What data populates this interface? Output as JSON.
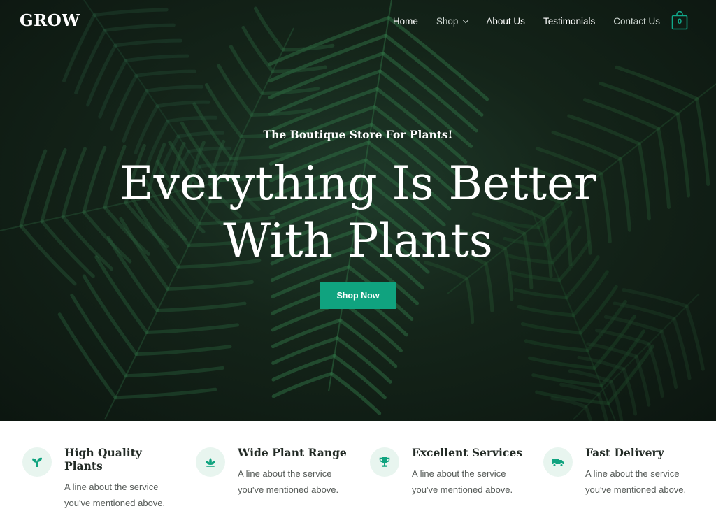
{
  "brand": {
    "logo": "GROW"
  },
  "nav": {
    "items": [
      {
        "label": "Home"
      },
      {
        "label": "Shop"
      },
      {
        "label": "About Us"
      },
      {
        "label": "Testimonials"
      },
      {
        "label": "Contact Us"
      }
    ],
    "cart_count": "0"
  },
  "hero": {
    "tagline": "The Boutique Store For Plants!",
    "headline_line1": "Everything Is Better",
    "headline_line2": "With Plants",
    "cta_label": "Shop Now"
  },
  "features": [
    {
      "icon": "sprout-icon",
      "title": "High Quality Plants",
      "description": "A line about the service you've mentioned above."
    },
    {
      "icon": "lotus-icon",
      "title": "Wide Plant Range",
      "description": "A line about the service you've mentioned above."
    },
    {
      "icon": "trophy-icon",
      "title": "Excellent Services",
      "description": "A line about the service you've mentioned above."
    },
    {
      "icon": "truck-icon",
      "title": "Fast Delivery",
      "description": "A line about the service you've mentioned above."
    }
  ],
  "colors": {
    "accent": "#10a37f",
    "icon_bg": "#e8f5ef",
    "hero_dark": "#0c1610"
  }
}
